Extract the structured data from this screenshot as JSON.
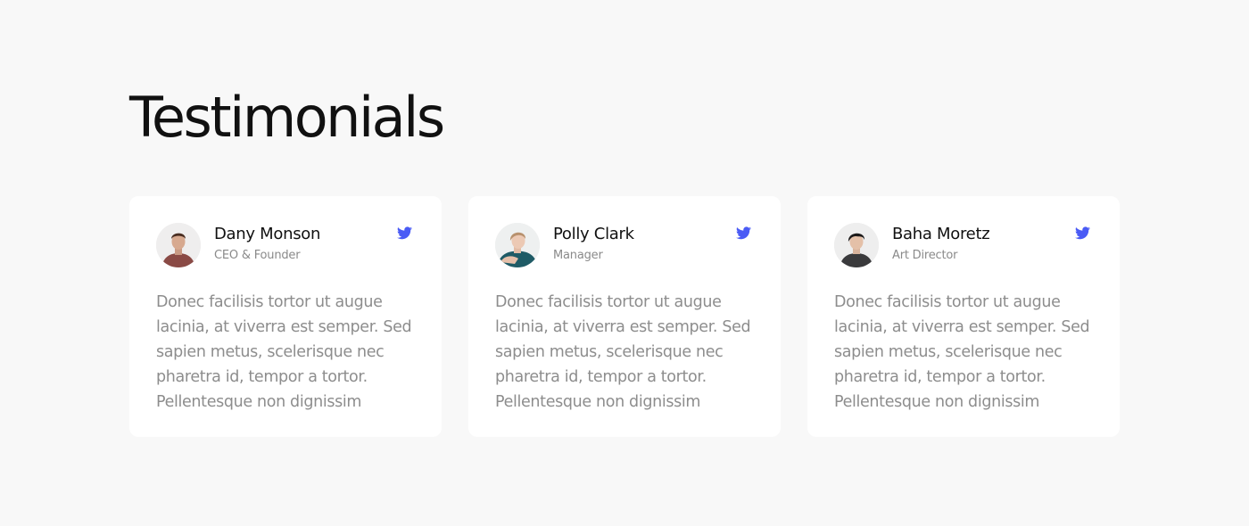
{
  "heading": "Testimonials",
  "accent_color": "#4a5bf5",
  "testimonials": [
    {
      "name": "Dany Monson",
      "role": "CEO & Founder",
      "avatar": "man-brown-shirt-avatar",
      "social_icon": "twitter-icon",
      "quote": "Donec facilisis tortor ut augue lacinia, at viverra est semper. Sed sapien metus, scelerisque nec pharetra id, tempor a tortor. Pellentesque non dignissim"
    },
    {
      "name": "Polly Clark",
      "role": "Manager",
      "avatar": "woman-teal-top-avatar",
      "social_icon": "twitter-icon",
      "quote": "Donec facilisis tortor ut augue lacinia, at viverra est semper. Sed sapien metus, scelerisque nec pharetra id, tempor a tortor. Pellentesque non dignissim"
    },
    {
      "name": "Baha Moretz",
      "role": "Art Director",
      "avatar": "man-dark-shirt-avatar",
      "social_icon": "twitter-icon",
      "quote": "Donec facilisis tortor ut augue lacinia, at viverra est semper. Sed sapien metus, scelerisque nec pharetra id, tempor a tortor. Pellentesque non dignissim"
    }
  ]
}
